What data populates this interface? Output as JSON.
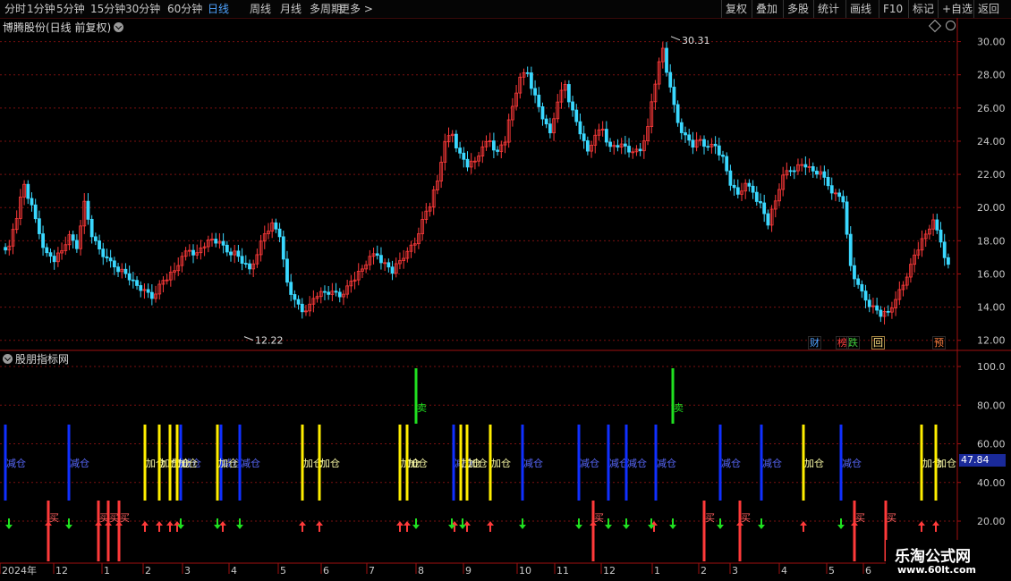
{
  "toolbar": {
    "left": [
      "分时",
      "1分钟",
      "5分钟",
      "15分钟",
      "30分钟",
      "60分钟",
      "日线",
      "周线",
      "月线",
      "多周期",
      "更多 >"
    ],
    "active": "日线",
    "right": [
      "复权",
      "叠加",
      "多股",
      "统计",
      "画线",
      "F10",
      "标记",
      "+自选",
      "返回"
    ]
  },
  "main": {
    "title": "博腾股份(日线 前复权)",
    "y_ticks": [
      "30.00",
      "28.00",
      "26.00",
      "24.00",
      "22.00",
      "20.00",
      "18.00",
      "16.00",
      "14.00",
      "12.00"
    ],
    "high_label": "30.31",
    "low_label": "12.22",
    "badges": [
      {
        "text": "财",
        "color": "#4fa3ff"
      },
      {
        "text": "榜",
        "color": "#ff4040"
      },
      {
        "text": "跌",
        "color": "#40d040"
      },
      {
        "text": "回",
        "color": "#ffe080"
      },
      {
        "text": "预",
        "color": "#ff8040"
      }
    ]
  },
  "indicator": {
    "title": "股朋指标网",
    "y_ticks": [
      "100.0",
      "80.00",
      "60.00",
      "40.00",
      "20.00"
    ],
    "current_value": "47.84",
    "labels": {
      "reduce": "减仓",
      "add": "加仓",
      "buy": "买",
      "sell": "卖"
    }
  },
  "x_axis": [
    "2024年",
    "12",
    "1",
    "2",
    "3",
    "4",
    "5",
    "6",
    "7",
    "8",
    "9",
    "10",
    "11",
    "12",
    "1",
    "2",
    "3",
    "4",
    "5",
    "6"
  ],
  "watermark": {
    "line1": "乐淘公式网",
    "line2": "www.60lt.com"
  },
  "colors": {
    "up": "#ff3a3a",
    "down": "#3ad8ff",
    "yellow": "#ffee00",
    "blue": "#1030ff",
    "green": "#20e020",
    "grid": "#7a1010"
  },
  "chart_data": {
    "type": "candlestick",
    "title": "博腾股份(日线 前复权)",
    "price_range": [
      11.5,
      31.0
    ],
    "price_high": 30.31,
    "price_low": 12.22,
    "close_series": [
      17.6,
      19.5,
      21.4,
      20.0,
      18.5,
      17.2,
      16.9,
      17.4,
      18.2,
      17.6,
      20.3,
      18.4,
      17.5,
      16.8,
      16.5,
      16.2,
      15.8,
      15.3,
      14.9,
      14.6,
      15.3,
      15.8,
      16.2,
      16.9,
      17.5,
      17.2,
      17.8,
      18.1,
      17.8,
      17.4,
      17.3,
      16.8,
      16.3,
      17.0,
      18.5,
      19.0,
      18.4,
      15.5,
      14.3,
      13.8,
      14.1,
      14.8,
      14.9,
      14.8,
      14.7,
      15.2,
      15.8,
      16.3,
      16.9,
      17.2,
      16.6,
      16.2,
      16.8,
      17.2,
      17.9,
      19.2,
      20.2,
      21.6,
      23.8,
      24.5,
      23.2,
      22.6,
      22.8,
      23.5,
      24.1,
      23.3,
      24.1,
      26.1,
      27.7,
      28.2,
      26.7,
      25.5,
      24.5,
      26.2,
      27.5,
      25.8,
      24.6,
      23.4,
      24.2,
      24.8,
      23.6,
      23.8,
      23.7,
      23.2,
      23.5,
      24.8,
      27.6,
      29.6,
      27.1,
      25.2,
      24.3,
      23.8,
      24.1,
      23.5,
      23.8,
      23.0,
      21.5,
      20.8,
      21.3,
      21.0,
      20.2,
      19.1,
      20.4,
      21.8,
      22.3,
      22.5,
      22.6,
      22.2,
      22.0,
      21.4,
      20.8,
      20.5,
      16.5,
      15.2,
      14.5,
      14.0,
      13.6,
      13.7,
      14.3,
      15.4,
      16.5,
      17.6,
      18.4,
      19.1,
      18.0,
      16.5
    ]
  }
}
